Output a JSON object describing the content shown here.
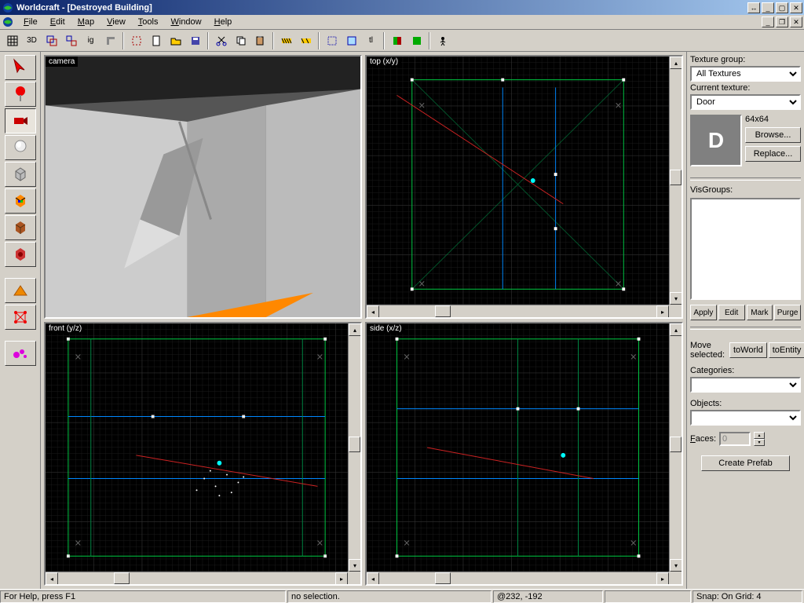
{
  "window": {
    "title": "Worldcraft - [Destroyed Building]"
  },
  "menus": [
    "File",
    "Edit",
    "Map",
    "View",
    "Tools",
    "Window",
    "Help"
  ],
  "toolbar": {
    "items": [
      "grid-small",
      "grid-3d",
      "group",
      "ungroup",
      "ig",
      "carve",
      "sep",
      "new",
      "open",
      "save",
      "sep",
      "cut",
      "copy",
      "paste",
      "sep",
      "hazard",
      "hazard2",
      "sep",
      "select",
      "select2",
      "tl",
      "sep",
      "tex1",
      "tex2",
      "sep",
      "run"
    ]
  },
  "palette": {
    "tools": [
      {
        "name": "selection-tool",
        "svg": "arrow-red"
      },
      {
        "name": "magnify-tool",
        "svg": "pin"
      },
      {
        "name": "camera-tool",
        "svg": "cam",
        "sel": true
      },
      {
        "name": "entity-tool",
        "svg": "sphere"
      },
      {
        "name": "block-tool",
        "svg": "cube"
      },
      {
        "name": "texture-app-tool",
        "svg": "rubik"
      },
      {
        "name": "apply-decal-tool",
        "svg": "brick1"
      },
      {
        "name": "clipping-tool",
        "svg": "brick2"
      }
    ],
    "tools2": [
      {
        "name": "vertex-tool",
        "svg": "wedge"
      },
      {
        "name": "path-tool",
        "svg": "lattice"
      }
    ],
    "tools3": [
      {
        "name": "morph-tool",
        "svg": "morph"
      }
    ]
  },
  "viewports": {
    "camera": "camera",
    "top": "top (x/y)",
    "front": "front (y/z)",
    "side": "side (x/z)"
  },
  "right": {
    "textureGroupLabel": "Texture group:",
    "textureGroupValue": "All Textures",
    "currentTextureLabel": "Current texture:",
    "currentTextureValue": "Door",
    "textureGlyph": "D",
    "textureSize": "64x64",
    "browse": "Browse...",
    "replace": "Replace...",
    "visgroupsLabel": "VisGroups:",
    "apply": "Apply",
    "edit": "Edit",
    "mark": "Mark",
    "purge": "Purge",
    "moveSelected": "Move selected:",
    "toWorld": "toWorld",
    "toEntity": "toEntity",
    "categoriesLabel": "Categories:",
    "categoriesValue": "",
    "objectsLabel": "Objects:",
    "objectsValue": "",
    "facesLabel": "Faces:",
    "facesValue": "0",
    "createPrefab": "Create Prefab"
  },
  "status": {
    "help": "For Help, press F1",
    "sel": "no selection.",
    "coords": "@232, -192",
    "zoom": "",
    "snap": "Snap: On Grid: 4"
  }
}
